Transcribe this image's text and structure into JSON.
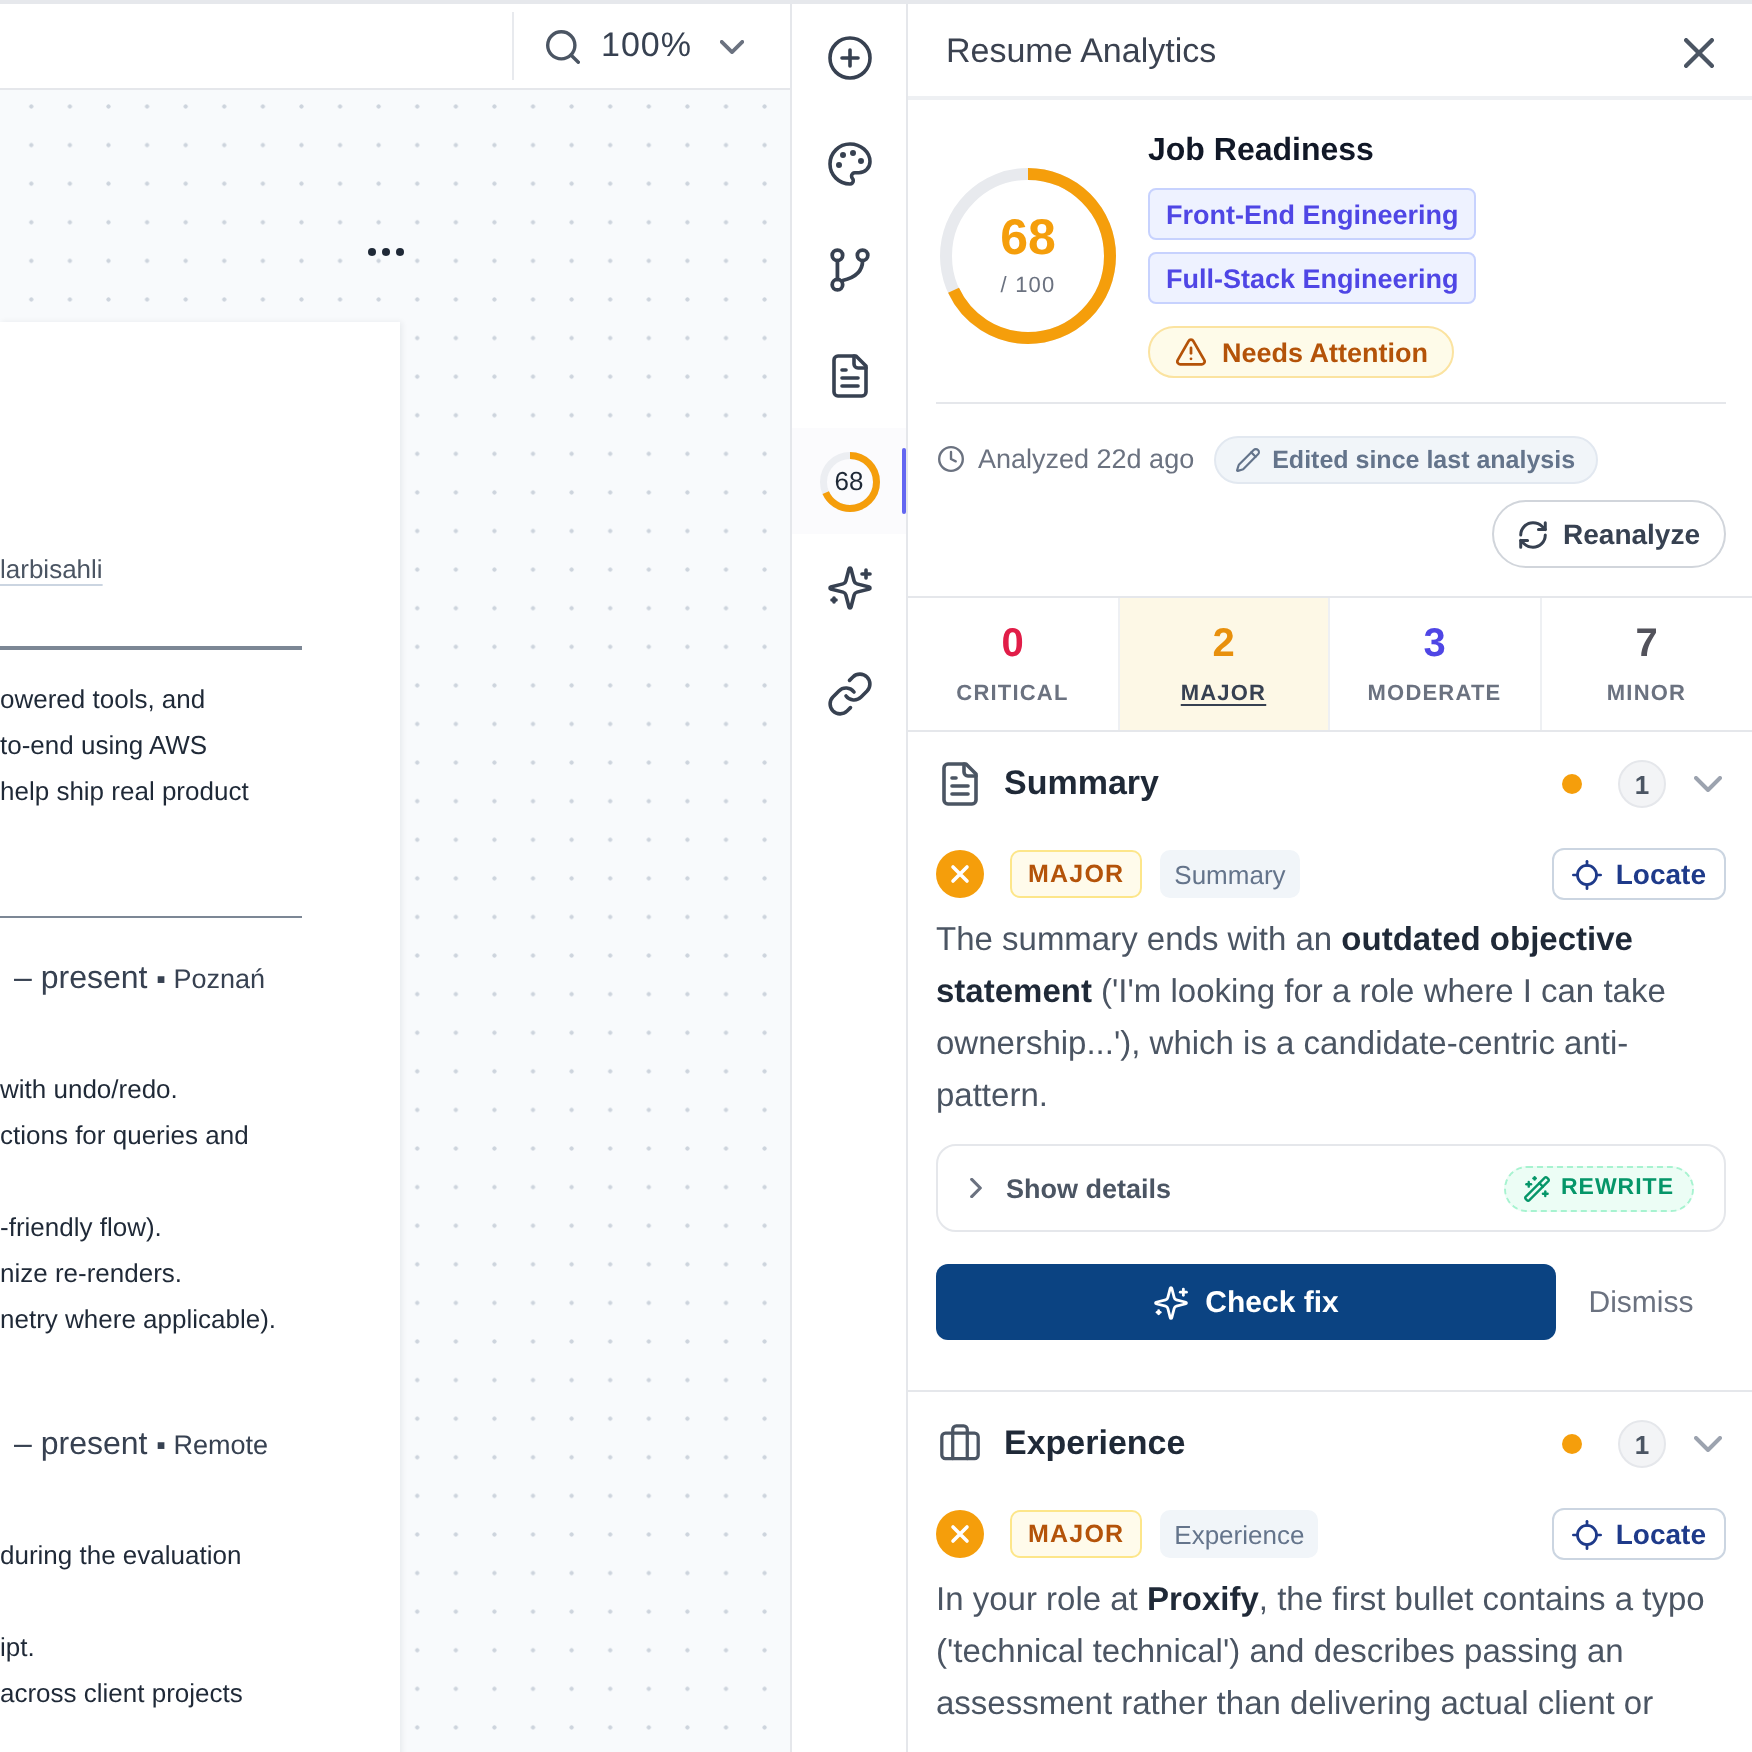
{
  "canvas": {
    "zoom": "100%",
    "document": {
      "contact_link": "larbisahli",
      "sections": [
        {
          "blocks": [
            [
              "owered tools, and",
              "to-end using AWS",
              "help ship real product"
            ]
          ]
        },
        {
          "entries": [
            {
              "dates": "– present",
              "location": "▪ Poznań",
              "blocks": [
                [
                  "with undo/redo.",
                  "ctions for queries and"
                ],
                [
                  "-friendly flow).",
                  "nize re-renders.",
                  "netry where applicable)."
                ]
              ]
            },
            {
              "dates": "– present",
              "location": "▪ Remote",
              "blocks": [
                [
                  "during the evaluation"
                ],
                [
                  "ipt.",
                  "across client projects"
                ]
              ]
            }
          ]
        }
      ]
    }
  },
  "rail": [
    {
      "kind": "add",
      "selected": false
    },
    {
      "kind": "palette",
      "selected": false
    },
    {
      "kind": "branch",
      "selected": false
    },
    {
      "kind": "document",
      "selected": false
    },
    {
      "kind": "score",
      "label": "68",
      "level": 0.68,
      "selected": true
    },
    {
      "kind": "sparkles",
      "selected": false
    },
    {
      "kind": "link",
      "selected": false
    }
  ],
  "panel": {
    "title": "Resume Analytics",
    "score": {
      "value": "68",
      "total": "/ 100",
      "level": 0.68
    },
    "readiness": {
      "title": "Job Readiness",
      "roles": [
        "Front-End Engineering",
        "Full-Stack Engineering"
      ],
      "status": {
        "kind": "warning",
        "label": "Needs Attention"
      }
    },
    "analysis": {
      "analyzed": "Analyzed 22d ago",
      "edited": "Edited since last analysis",
      "button": "Reanalyze"
    },
    "severity_tabs": [
      {
        "count": "0",
        "label": "CRITICAL",
        "color": "#e11d48",
        "selected": false
      },
      {
        "count": "2",
        "label": "MAJOR",
        "color": "#e8900c",
        "selected": true
      },
      {
        "count": "3",
        "label": "MODERATE",
        "color": "#4f46e5",
        "selected": false
      },
      {
        "count": "7",
        "label": "MINOR",
        "color": "#52525b",
        "selected": false
      }
    ],
    "sections": [
      {
        "kind": "summary",
        "title": "Summary",
        "color": "#f59e0b",
        "count": "1",
        "expanded": true,
        "issues": [
          {
            "kind": "major",
            "severity": "MAJOR",
            "tag": "Summary",
            "locate": "Locate",
            "text": "The summary ends with an **outdated objective statement** ('I'm looking for a role where I can take ownership...'), which is a candidate-centric anti-pattern.",
            "details": {
              "label": "Show details",
              "expanded": false,
              "fix": "REWRITE"
            },
            "actions": {
              "primary": "Check fix",
              "secondary": "Dismiss"
            }
          }
        ]
      },
      {
        "kind": "experience",
        "title": "Experience",
        "color": "#f59e0b",
        "count": "1",
        "expanded": true,
        "issues": [
          {
            "kind": "major",
            "severity": "MAJOR",
            "tag": "Experience",
            "locate": "Locate",
            "text": "In your role at **Proxify**, the first bullet contains a typo ('technical technical') and describes passing an assessment rather than delivering actual client or"
          }
        ]
      }
    ]
  }
}
